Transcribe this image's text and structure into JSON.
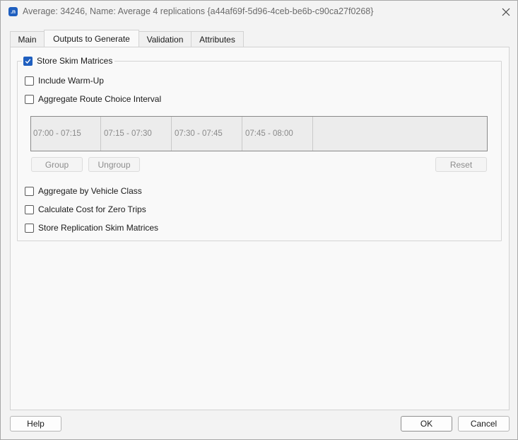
{
  "window": {
    "title": "Average: 34246, Name: Average 4 replications  {a44af69f-5d96-4ceb-be6b-c90ca27f0268}",
    "app_icon_glyph": ".n",
    "close_glyph": "✕"
  },
  "tabs": [
    {
      "label": "Main",
      "active": false
    },
    {
      "label": "Outputs to Generate",
      "active": true
    },
    {
      "label": "Validation",
      "active": false
    },
    {
      "label": "Attributes",
      "active": false
    }
  ],
  "outputs": {
    "store_skim_matrices": {
      "label": "Store Skim Matrices",
      "checked": true
    },
    "include_warm_up": {
      "label": "Include Warm-Up",
      "checked": false
    },
    "aggregate_route_choice": {
      "label": "Aggregate Route Choice Interval",
      "checked": false
    },
    "intervals": [
      "07:00 - 07:15",
      "07:15 - 07:30",
      "07:30 - 07:45",
      "07:45 - 08:00"
    ],
    "group_button": "Group",
    "ungroup_button": "Ungroup",
    "reset_button": "Reset",
    "aggregate_vehicle_class": {
      "label": "Aggregate by Vehicle Class",
      "checked": false
    },
    "cost_zero_trips": {
      "label": "Calculate Cost for Zero Trips",
      "checked": false
    },
    "store_replication_skim": {
      "label": "Store Replication Skim Matrices",
      "checked": false
    }
  },
  "footer": {
    "help_button": "Help",
    "ok_button": "OK",
    "cancel_button": "Cancel"
  },
  "colors": {
    "accent": "#1f5fbf",
    "window_bg": "#f3f3f3",
    "panel_bg": "#f9f9f9"
  }
}
